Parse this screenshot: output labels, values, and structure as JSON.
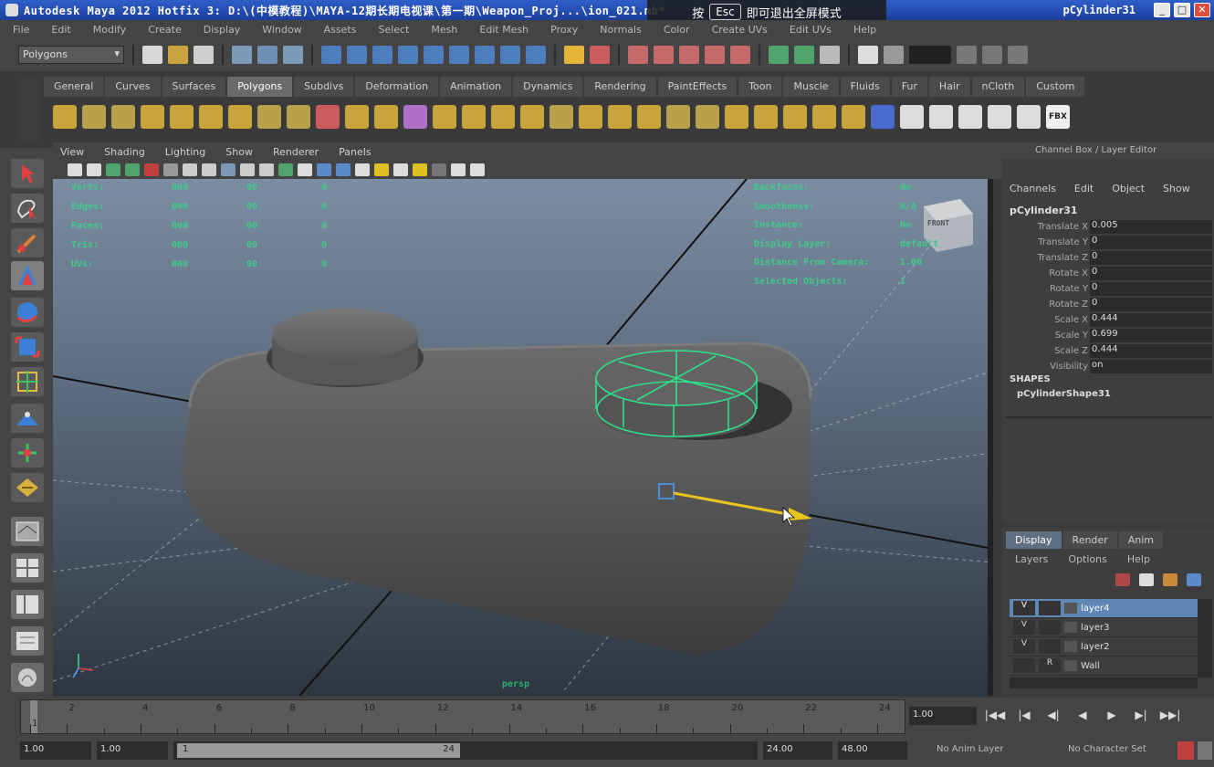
{
  "window": {
    "title": "Autodesk Maya 2012 Hotfix 3: D:\\(中模教程)\\MAYA-12期长期电视课\\第一期\\Weapon_Proj...\\ion_021.mb*",
    "title_right": "pCylinder31",
    "min_symbol": "_",
    "max_symbol": "□",
    "close_symbol": "✕"
  },
  "fullscreen_toast": {
    "press": "按",
    "key": "Esc",
    "message": "即可退出全屏模式"
  },
  "menubar": [
    "File",
    "Edit",
    "Modify",
    "Create",
    "Display",
    "Window",
    "Assets",
    "Select",
    "Mesh",
    "Edit Mesh",
    "Proxy",
    "Normals",
    "Color",
    "Create UVs",
    "Edit UVs",
    "Help"
  ],
  "status_line": {
    "mode": "Polygons"
  },
  "shelf": {
    "tabs": [
      "General",
      "Curves",
      "Surfaces",
      "Polygons",
      "Subdivs",
      "Deformation",
      "Animation",
      "Dynamics",
      "Rendering",
      "PaintEffects",
      "Toon",
      "Muscle",
      "Fluids",
      "Fur",
      "Hair",
      "nCloth",
      "Custom"
    ],
    "active_tab": "Polygons",
    "icon_count_label": "FBX"
  },
  "panel": {
    "menu": [
      "View",
      "Shading",
      "Lighting",
      "Show",
      "Renderer",
      "Panels"
    ]
  },
  "hud": {
    "left_labels": [
      "Verts:",
      "Edges:",
      "Faces:",
      "Tris:",
      "UVs:"
    ],
    "left_col1": [
      "000",
      "000",
      "000",
      "000",
      "000"
    ],
    "left_col2": [
      "00",
      "00",
      "00",
      "00",
      "00"
    ],
    "left_col3": [
      "0",
      "0",
      "0",
      "0",
      "0"
    ],
    "right_labels": [
      "Backfaces:",
      "Smoothness:",
      "Instance:",
      "Display Layer:",
      "Distance From Camera:",
      "Selected Objects:"
    ],
    "right_values": [
      "No",
      "N/A",
      "No",
      "default",
      "1.00",
      "1"
    ],
    "view_cube": "FRONT",
    "camera_label": "persp"
  },
  "channel_box": {
    "header": "Channel Box / Layer Editor",
    "tabs": [
      "Channels",
      "Edit",
      "Object",
      "Show"
    ],
    "object": "pCylinder31",
    "attrs": [
      {
        "label": "Translate X",
        "value": "0.005"
      },
      {
        "label": "Translate Y",
        "value": "0"
      },
      {
        "label": "Translate Z",
        "value": "0"
      },
      {
        "label": "Rotate X",
        "value": "0"
      },
      {
        "label": "Rotate Y",
        "value": "0"
      },
      {
        "label": "Rotate Z",
        "value": "0"
      },
      {
        "label": "Scale X",
        "value": "0.444"
      },
      {
        "label": "Scale Y",
        "value": "0.699"
      },
      {
        "label": "Scale Z",
        "value": "0.444"
      },
      {
        "label": "Visibility",
        "value": "on"
      }
    ],
    "shapes_header": "SHAPES",
    "shape_name": "pCylinderShape31"
  },
  "layer_editor": {
    "tabs": [
      "Display",
      "Render",
      "Anim"
    ],
    "menu": [
      "Layers",
      "Options",
      "Help"
    ],
    "rows": [
      {
        "v": "V",
        "t": "",
        "name": "layer4",
        "selected": true
      },
      {
        "v": "V",
        "t": "",
        "name": "layer3",
        "selected": false
      },
      {
        "v": "V",
        "t": "",
        "name": "layer2",
        "selected": false
      },
      {
        "v": "",
        "t": "R",
        "name": "Wall",
        "selected": false
      }
    ]
  },
  "time_slider": {
    "ticks": [
      "1",
      "2",
      "4",
      "6",
      "8",
      "10",
      "12",
      "14",
      "16",
      "18",
      "20",
      "22",
      "24"
    ],
    "current_time": "1.00",
    "play_buttons": [
      "|◀◀",
      "|◀",
      "◀|",
      "◀",
      "▶",
      "▶|",
      "▶▶|"
    ]
  },
  "range_slider": {
    "start": "1.00",
    "playback_start": "1.00",
    "thumb_start": "1",
    "thumb_end": "24",
    "playback_end": "24.00",
    "end": "48.00",
    "anim_layer": "No Anim Layer",
    "character_set": "No Character Set"
  },
  "colors": {
    "selection_green": "#2ee08a",
    "object_gray": "#5d5d5d",
    "selected_layer": "#5f86b4"
  }
}
